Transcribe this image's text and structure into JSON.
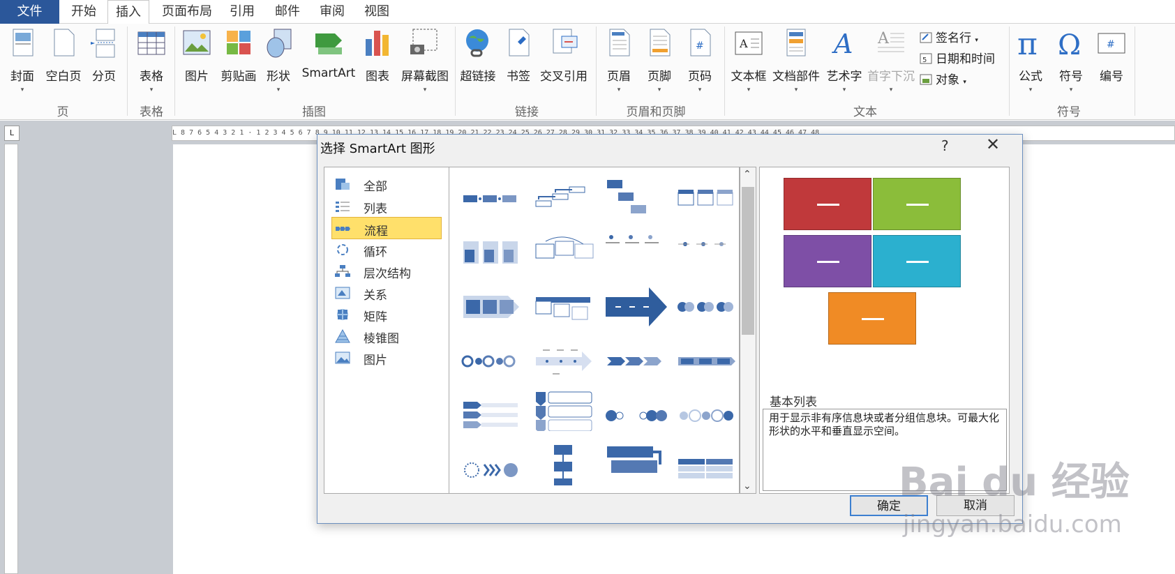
{
  "tabs": {
    "file": "文件",
    "home": "开始",
    "insert": "插入",
    "layout": "页面布局",
    "refs": "引用",
    "mail": "邮件",
    "review": "审阅",
    "view": "视图"
  },
  "ribbon": {
    "pages": {
      "cover": "封面",
      "blank": "空白页",
      "break": "分页",
      "group": "页"
    },
    "tables": {
      "table": "表格",
      "group": "表格"
    },
    "illus": {
      "picture": "图片",
      "clipart": "剪贴画",
      "shapes": "形状",
      "smartart": "SmartArt",
      "chart": "图表",
      "screenshot": "屏幕截图",
      "group": "插图"
    },
    "links": {
      "hyperlink": "超链接",
      "bookmark": "书签",
      "crossref": "交叉引用",
      "group": "链接"
    },
    "hf": {
      "header": "页眉",
      "footer": "页脚",
      "pagenum": "页码",
      "group": "页眉和页脚"
    },
    "text": {
      "textbox": "文本框",
      "quickparts": "文档部件",
      "wordart": "艺术字",
      "dropcap": "首字下沉",
      "signature": "签名行",
      "datetime": "日期和时间",
      "object": "对象",
      "group": "文本"
    },
    "symbols": {
      "equation": "公式",
      "symbol": "符号",
      "numbering": "编号",
      "group": "符号"
    }
  },
  "ruler": {
    "h_ticks": "L 8 7 6 5 4 3 2 1 · 1 2 3 4 5 6 7 8 9 10 11 12 13 14 15 16 17 18 19 20 21 22 23 24 25 26 27 28 29 30 31 32 33 34 35 36 37 38 39 40 41 42 43 44 45 46 47 48"
  },
  "dialog": {
    "title": "选择 SmartArt 图形",
    "help": "?",
    "close": "✕",
    "categories": [
      "全部",
      "列表",
      "流程",
      "循环",
      "层次结构",
      "关系",
      "矩阵",
      "棱锥图",
      "图片"
    ],
    "selected_category": "流程",
    "preview_name": "基本列表",
    "preview_desc": "用于显示非有序信息块或者分组信息块。可最大化形状的水平和垂直显示空间。",
    "ok": "确定",
    "cancel": "取消",
    "colors": {
      "red": "#c0393b",
      "green": "#8bbd3a",
      "purple": "#7e4fa6",
      "cyan": "#2bb0cf",
      "orange": "#f08b25",
      "accent": "#3b68a9"
    }
  },
  "watermark": {
    "brand": "Bai du 经验",
    "url": "jingyan.baidu.com"
  }
}
